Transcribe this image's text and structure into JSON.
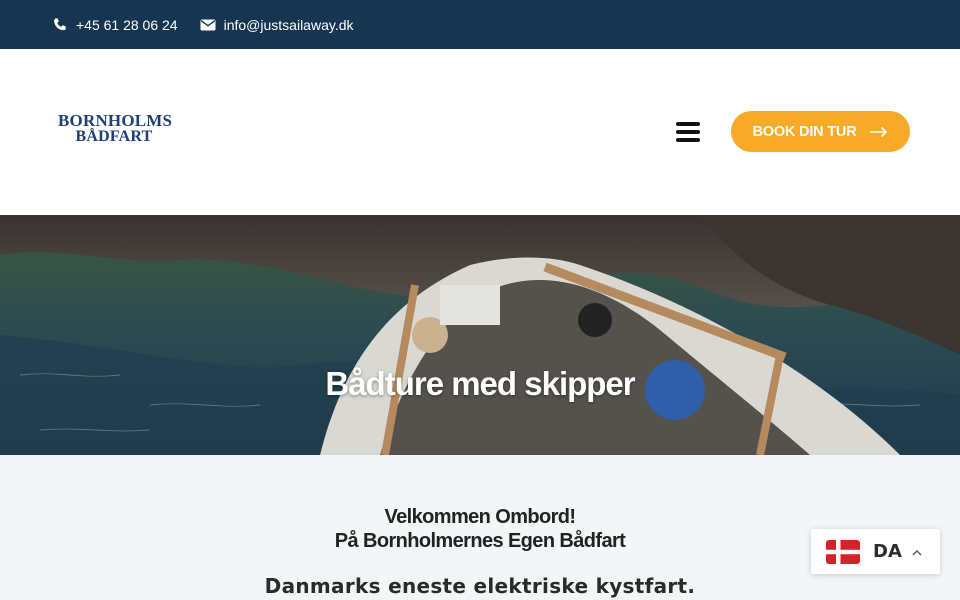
{
  "topbar": {
    "phone": "+45 61 28 06 24",
    "email": "info@justsailaway.dk"
  },
  "header": {
    "logo_line1": "BORNHOLMS",
    "logo_line2": "BÅDFART",
    "book_label": "BOOK DIN TUR"
  },
  "hero": {
    "title": "Bådture med skipper"
  },
  "content": {
    "welcome_line1": "Velkommen Ombord!",
    "welcome_line2": "På Bornholmernes Egen Bådfart",
    "tagline": "Danmarks eneste elektriske kystfart."
  },
  "language": {
    "code": "DA",
    "flag": "denmark-flag-icon"
  },
  "colors": {
    "topbar_bg": "#153550",
    "accent": "#f7a928",
    "logo": "#1f3e76"
  }
}
